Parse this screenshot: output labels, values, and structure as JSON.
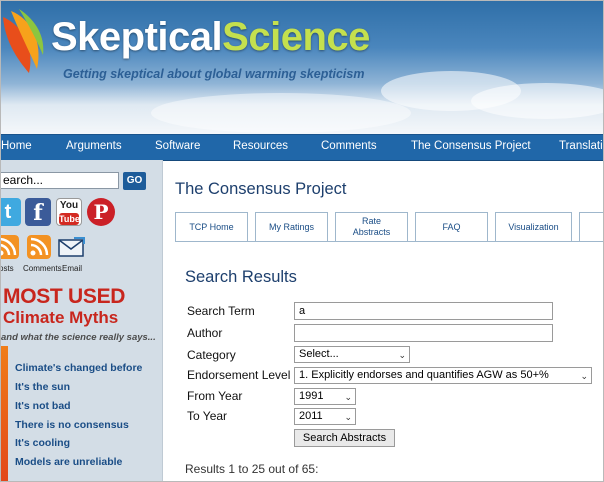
{
  "header": {
    "site_name_part1": "Skeptical",
    "site_name_part2": "Science",
    "tagline": "Getting skeptical about global warming skepticism"
  },
  "nav": {
    "items": [
      "Home",
      "Arguments",
      "Software",
      "Resources",
      "Comments",
      "The Consensus Project",
      "Translati"
    ]
  },
  "sidebar": {
    "search": {
      "value": "earch..."
    },
    "go_label": "GO",
    "social": {
      "twitter": "t",
      "facebook": "f",
      "youtube_top": "You",
      "youtube_bottom": "Tube",
      "pinterest": "P"
    },
    "feeds": {
      "posts": "osts",
      "comments": "Comments",
      "email": "Email"
    },
    "myths": {
      "title": "MOST USED",
      "subtitle": "Climate Myths",
      "tagline": "and what the science really says...",
      "items": [
        "Climate's changed before",
        "It's the sun",
        "It's not bad",
        "There is no consensus",
        "It's cooling",
        "Models are unreliable"
      ]
    }
  },
  "main": {
    "page_title": "The Consensus Project",
    "tabs": [
      {
        "label": "TCP Home"
      },
      {
        "label": "My Ratings"
      },
      {
        "label": "Rate\nAbstracts"
      },
      {
        "label": "FAQ"
      },
      {
        "label": "Visualization"
      }
    ],
    "section_title": "Search Results",
    "form": {
      "search_term": {
        "label": "Search Term",
        "value": "a"
      },
      "author": {
        "label": "Author",
        "value": ""
      },
      "category": {
        "label": "Category",
        "value": "Select..."
      },
      "endorsement_level": {
        "label": "Endorsement Level",
        "value": "1. Explicitly endorses and quantifies AGW as 50+%"
      },
      "from_year": {
        "label": "From Year",
        "value": "1991"
      },
      "to_year": {
        "label": "To Year",
        "value": "2011"
      },
      "submit_label": "Search Abstracts"
    },
    "results_text": "Results 1 to 25 out of 65:"
  },
  "colors": {
    "nav_bg": "#2067a9",
    "sidebar_bg": "#d3dde6",
    "brand_green": "#c4e04e",
    "myth_red": "#c8261d",
    "link_blue": "#1a4d86"
  }
}
